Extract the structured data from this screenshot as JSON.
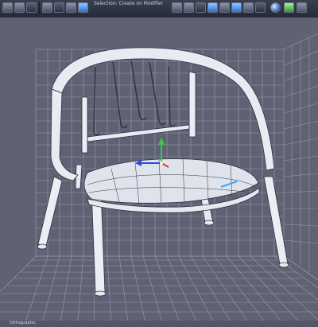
{
  "toolbar": {
    "mode_text": "Selection: Create on Modifier",
    "tools": [
      {
        "icon": "select-arrow-icon"
      },
      {
        "icon": "move-icon"
      },
      {
        "icon": "rotate-icon"
      },
      {
        "icon": "scale-icon"
      },
      {
        "icon": "snap-icon"
      },
      {
        "icon": "undo-icon"
      },
      {
        "icon": "redo-icon"
      },
      {
        "icon": "link-icon"
      },
      {
        "icon": "camera-icon"
      },
      {
        "icon": "light-icon"
      },
      {
        "icon": "grid-icon"
      },
      {
        "icon": "globe-icon"
      }
    ]
  },
  "viewport": {
    "object": "chair",
    "status_text": "Orthographic"
  },
  "colors": {
    "background": "#5f6273",
    "grid": "#9ea2b2",
    "wire": "#c9ccd8",
    "model_fill": "#d9dde8"
  }
}
